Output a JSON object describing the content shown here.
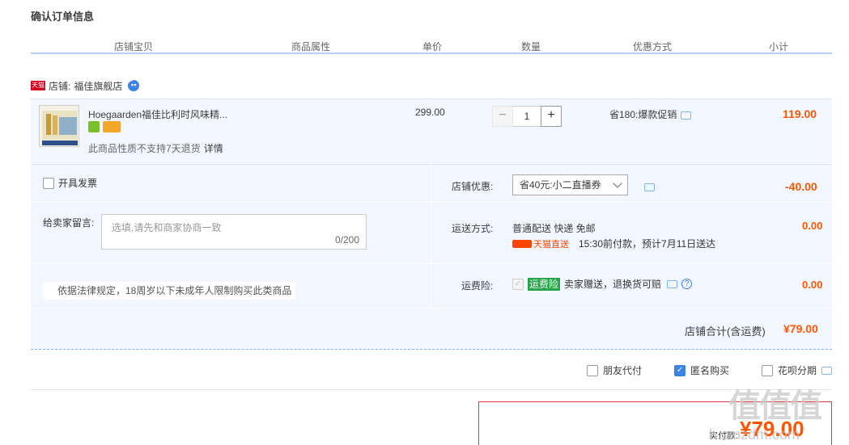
{
  "page": {
    "title": "确认订单信息"
  },
  "table_header": [
    "店铺宝贝",
    "商品属性",
    "单价",
    "数量",
    "优惠方式",
    "小计"
  ],
  "shop": {
    "badge": "天猫",
    "label": "店铺:",
    "name": "福佳旗舰店"
  },
  "item": {
    "title": "Hoegaarden福佳比利时风味精...",
    "note": "此商品性质不支持7天退货",
    "note_link": "详情",
    "price": "299.00",
    "quantity": "1",
    "minus": "−",
    "plus": "+",
    "promo": "省180:爆款促销",
    "subtotal": "119.00"
  },
  "invoice": {
    "label": "开具发票"
  },
  "message": {
    "label": "给卖家留言:",
    "placeholder": "选填,请先和商家协商一致",
    "count": "0/200"
  },
  "law_notice": "依据法律规定，18周岁以下未成年人限制购买此类商品",
  "coupon": {
    "label": "店铺优惠:",
    "selected": "省40元:小二直播券",
    "amount": "-40.00"
  },
  "shipping": {
    "label": "运送方式:",
    "method": "普通配送 快递 免邮",
    "tmall_tag": "天猫直送",
    "eta": "15:30前付款，预计7月11日送达",
    "fee": "0.00"
  },
  "insurance": {
    "label": "运费险:",
    "badge": "运费险",
    "text": "卖家赠送，退换货可赔",
    "help": "?",
    "fee": "0.00"
  },
  "shop_total": {
    "label": "店铺合计(含运费)",
    "value": "¥79.00"
  },
  "options": [
    {
      "label": "朋友代付",
      "checked": false
    },
    {
      "label": "匿名购买",
      "checked": true
    },
    {
      "label": "花呗分期",
      "checked": false
    }
  ],
  "pay": {
    "label": "实付款:",
    "value": "¥79.00"
  },
  "watermark": {
    "big": "值值值",
    "small": "h.smzdm.com"
  },
  "colors": {
    "accent_price": "#ff5500",
    "header_line": "#b2d1ff",
    "panel_bg": "#f2f7ff",
    "insurance_green": "#27a54a"
  }
}
